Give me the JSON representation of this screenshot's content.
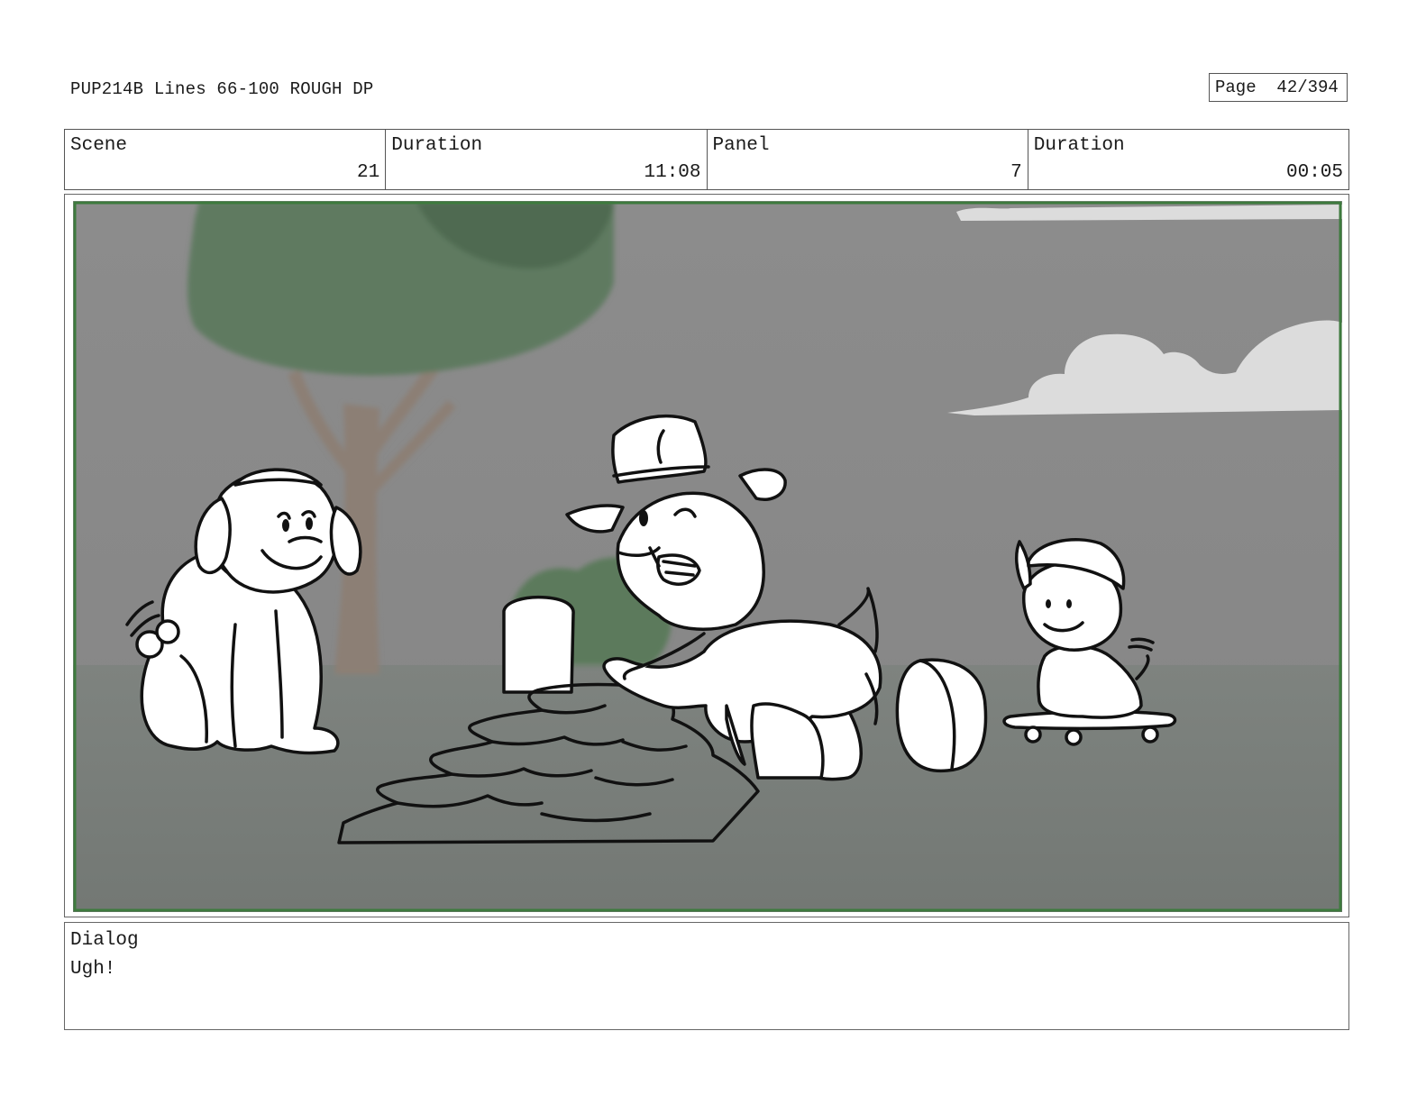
{
  "header": {
    "title": "PUP214B Lines 66-100 ROUGH DP",
    "page_label": "Page",
    "page_value": "42/394"
  },
  "info": {
    "scene_label": "Scene",
    "scene_value": "21",
    "duration_label": "Duration",
    "duration_value": "11:08",
    "panel_label": "Panel",
    "panel_value": "7",
    "panel_duration_label": "Duration",
    "panel_duration_value": "00:05"
  },
  "dialog": {
    "label": "Dialog",
    "text": "Ugh!"
  },
  "colors": {
    "frame_green": "#3d7a3d",
    "sky_gray": "#8a8a8a",
    "ground_gray": "#7a7f7b",
    "tree_blue": "#2a9df4",
    "tree_green": "#5a7a5a",
    "cloud": "#dcdcdc"
  }
}
